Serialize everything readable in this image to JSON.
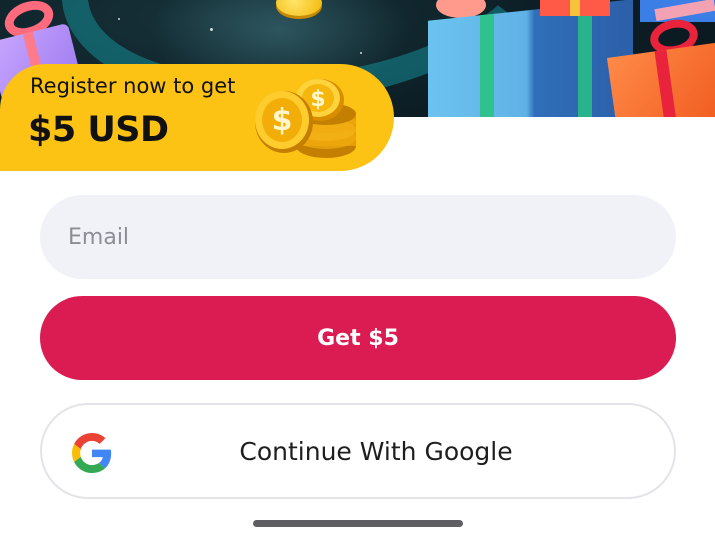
{
  "promo": {
    "subtitle": "Register now to get",
    "amount": "$5 USD"
  },
  "form": {
    "email_placeholder": "Email",
    "submit_label": "Get $5",
    "google_label": "Continue With Google"
  },
  "colors": {
    "promo_yellow": "#fcc314",
    "primary_red": "#da1c52",
    "field_bg": "#f1f2f7"
  },
  "icons": {
    "promo": "stacked-gold-coins-icon",
    "google": "google-g-icon"
  }
}
